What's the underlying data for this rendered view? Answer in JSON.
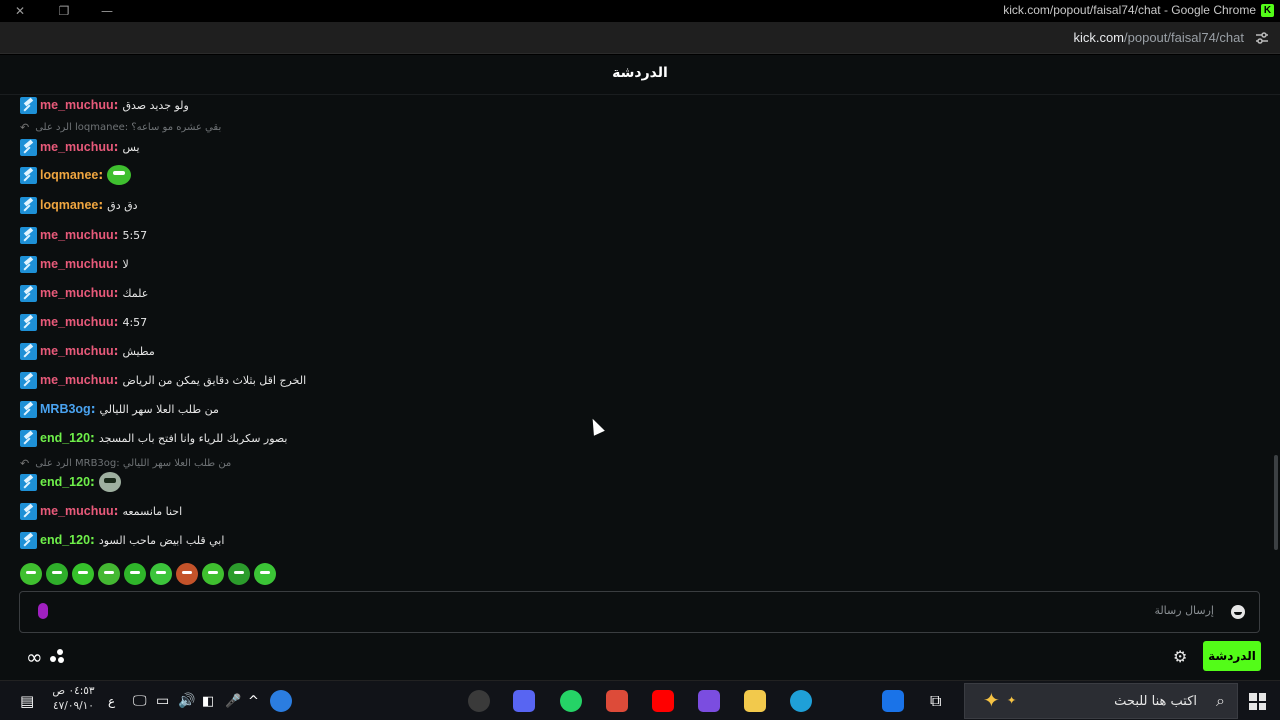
{
  "window": {
    "title": "kick.com/popout/faisal74/chat - Google Chrome",
    "favicon_letter": "K",
    "url_host": "kick.com",
    "url_path": "/popout/faisal74/chat"
  },
  "chat": {
    "title": "الدردشة",
    "input_placeholder": "إرسال رسالة",
    "send_tab_label": "الدردشة",
    "colors": {
      "me_muchuu": "#e85a7a",
      "loqmanee": "#f0a640",
      "MRB3og": "#4aa3f0",
      "end_120": "#6ff04a",
      "accent": "#53fc18"
    },
    "messages": [
      {
        "type": "msg",
        "user": "me_muchuu",
        "text": "ولو جديد صدق",
        "colorKey": "me_muchuu"
      },
      {
        "type": "reply",
        "text": "الرد على loqmanee: بقي عشره مو ساعه؟"
      },
      {
        "type": "msg",
        "user": "me_muchuu",
        "text": "يس",
        "colorKey": "me_muchuu"
      },
      {
        "type": "msg",
        "user": "loqmanee",
        "text": "",
        "emote": "emote-grin",
        "colorKey": "loqmanee"
      },
      {
        "type": "msg",
        "user": "loqmanee",
        "text": "دق دق",
        "colorKey": "loqmanee"
      },
      {
        "type": "msg",
        "user": "me_muchuu",
        "text": "5:57",
        "colorKey": "me_muchuu"
      },
      {
        "type": "msg",
        "user": "me_muchuu",
        "text": "لا",
        "colorKey": "me_muchuu"
      },
      {
        "type": "msg",
        "user": "me_muchuu",
        "text": "علمك",
        "colorKey": "me_muchuu"
      },
      {
        "type": "msg",
        "user": "me_muchuu",
        "text": "4:57",
        "colorKey": "me_muchuu"
      },
      {
        "type": "msg",
        "user": "me_muchuu",
        "text": "مطيش",
        "colorKey": "me_muchuu"
      },
      {
        "type": "msg",
        "user": "me_muchuu",
        "text": "الخرج اقل بثلاث دقايق يمكن من الرياض",
        "colorKey": "me_muchuu"
      },
      {
        "type": "msg",
        "user": "MRB3og",
        "text": "من طلب العلا سهر الليالي",
        "colorKey": "MRB3og"
      },
      {
        "type": "msg",
        "user": "end_120",
        "text": "بصور سكربك للرياء وانا افتح باب المسجد",
        "colorKey": "end_120"
      },
      {
        "type": "reply",
        "text": "الرد على MRB3og: من طلب العلا سهر الليالي"
      },
      {
        "type": "msg",
        "user": "end_120",
        "text": "",
        "emote": "emote-skull",
        "colorKey": "end_120"
      },
      {
        "type": "msg",
        "user": "me_muchuu",
        "text": "احنا مانسمعه",
        "colorKey": "me_muchuu"
      },
      {
        "type": "msg",
        "user": "end_120",
        "text": "ابي قلب ابيض ماحب السود",
        "colorKey": "end_120"
      }
    ],
    "quick_emotes": [
      "#3fbf2f",
      "#2fae2a",
      "#36c12b",
      "#44b832",
      "#2fb52a",
      "#3cc43b",
      "#c4532a",
      "#3fbf2f",
      "#2c9c2c",
      "#3bc436"
    ]
  },
  "taskbar": {
    "clock_time": "٠٤:٥٣ ص",
    "clock_date": "٤٧/٠٩/١٠",
    "lang": "ع",
    "search_placeholder": "اكتب هنا للبحث",
    "apps": [
      {
        "name": "obs-icon",
        "color": "#3a3a3a"
      },
      {
        "name": "discord-icon",
        "color": "#5865f2"
      },
      {
        "name": "whatsapp-icon",
        "color": "#25d366"
      },
      {
        "name": "chrome-icon",
        "color": "#dd4b39"
      },
      {
        "name": "youtube-icon",
        "color": "#ff0000"
      },
      {
        "name": "m365-icon",
        "color": "#7b4de0"
      },
      {
        "name": "explorer-icon",
        "color": "#f2c94c"
      },
      {
        "name": "edge-icon",
        "color": "#1fa0d8"
      },
      {
        "name": "outlook-icon",
        "color": "#1a73e8"
      }
    ]
  }
}
